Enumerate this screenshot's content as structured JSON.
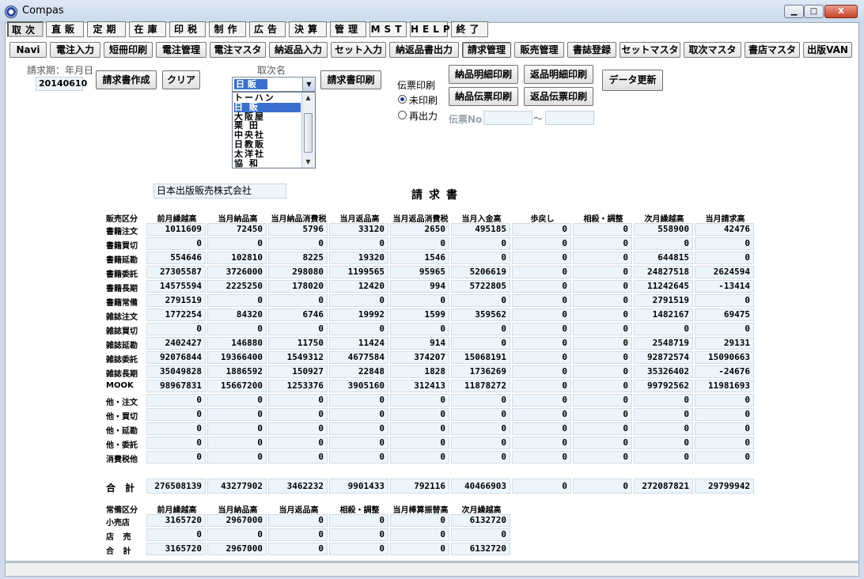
{
  "window": {
    "title": "Compas",
    "minimize": "▁",
    "maximize": "□",
    "close": "X"
  },
  "menu": [
    {
      "label": "取次"
    },
    {
      "label": "直販"
    },
    {
      "label": "定期"
    },
    {
      "label": "在庫"
    },
    {
      "label": "印税"
    },
    {
      "label": "制作"
    },
    {
      "label": "広告"
    },
    {
      "label": "決算"
    },
    {
      "label": "管理"
    },
    {
      "label": "MST"
    },
    {
      "label": "HELP"
    },
    {
      "label": "終了"
    }
  ],
  "submenu": [
    {
      "label": "Navi"
    },
    {
      "label": "電注入力"
    },
    {
      "label": "短冊印刷"
    },
    {
      "label": "電注管理"
    },
    {
      "label": "電注マスタ"
    },
    {
      "label": "納返品入力"
    },
    {
      "label": "セット入力"
    },
    {
      "label": "納返品書出力"
    },
    {
      "label": "請求管理"
    },
    {
      "label": "販売管理"
    },
    {
      "label": "書誌登録"
    },
    {
      "label": "セットマスタ"
    },
    {
      "label": "取次マスタ"
    },
    {
      "label": "書店マスタ"
    },
    {
      "label": "出版VAN"
    }
  ],
  "controls": {
    "period_label": "請求期：年月日",
    "period_value": "20140610",
    "create_btn": "請求書作成",
    "clear_btn": "クリア",
    "distributor_label": "取次名",
    "distributor_value": "日 販",
    "distributor_options": [
      "トーハン",
      "日 販",
      "大阪屋",
      "栗 田",
      "中央社",
      "日教販",
      "太洋社",
      "協 和"
    ],
    "print_invoice_btn": "請求書印刷",
    "slip_label": "伝票印刷",
    "radio_unprinted": "未印刷",
    "radio_reprint": "再出力",
    "delivery_detail_btn": "納品明細印刷",
    "return_detail_btn": "返品明細印刷",
    "delivery_slip_btn": "納品伝票印刷",
    "return_slip_btn": "返品伝票印刷",
    "update_btn": "データ更新",
    "slip_no_label": "伝票No",
    "slip_range": "〜"
  },
  "company": "日本出版販売株式会社",
  "doc_title": "請求書",
  "main_table": {
    "headers": [
      "販売区分",
      "前月繰越高",
      "当月納品高",
      "当月納品消費税",
      "当月返品高",
      "当月返品消費税",
      "当月入金高",
      "歩戻し",
      "相殺・調整",
      "次月繰越高",
      "当月請求高"
    ],
    "rows": [
      {
        "label": "書籍注文",
        "values": [
          "1011609",
          "72450",
          "5796",
          "33120",
          "2650",
          "495185",
          "0",
          "0",
          "558900",
          "42476"
        ]
      },
      {
        "label": "書籍買切",
        "values": [
          "0",
          "0",
          "0",
          "0",
          "0",
          "0",
          "0",
          "0",
          "0",
          "0"
        ]
      },
      {
        "label": "書籍延勘",
        "values": [
          "554646",
          "102810",
          "8225",
          "19320",
          "1546",
          "0",
          "0",
          "0",
          "644815",
          "0"
        ]
      },
      {
        "label": "書籍委託",
        "values": [
          "27305587",
          "3726000",
          "298080",
          "1199565",
          "95965",
          "5206619",
          "0",
          "0",
          "24827518",
          "2624594"
        ]
      },
      {
        "label": "書籍長期",
        "values": [
          "14575594",
          "2225250",
          "178020",
          "12420",
          "994",
          "5722805",
          "0",
          "0",
          "11242645",
          "-13414"
        ]
      },
      {
        "label": "書籍常備",
        "values": [
          "2791519",
          "0",
          "0",
          "0",
          "0",
          "0",
          "0",
          "0",
          "2791519",
          "0"
        ]
      },
      {
        "label": "雑誌注文",
        "values": [
          "1772254",
          "84320",
          "6746",
          "19992",
          "1599",
          "359562",
          "0",
          "0",
          "1482167",
          "69475"
        ]
      },
      {
        "label": "雑誌買切",
        "values": [
          "0",
          "0",
          "0",
          "0",
          "0",
          "0",
          "0",
          "0",
          "0",
          "0"
        ]
      },
      {
        "label": "雑誌延勘",
        "values": [
          "2402427",
          "146880",
          "11750",
          "11424",
          "914",
          "0",
          "0",
          "0",
          "2548719",
          "29131"
        ]
      },
      {
        "label": "雑誌委託",
        "values": [
          "92076844",
          "19366400",
          "1549312",
          "4677584",
          "374207",
          "15068191",
          "0",
          "0",
          "92872574",
          "15090663"
        ]
      },
      {
        "label": "雑誌長期",
        "values": [
          "35049828",
          "1886592",
          "150927",
          "22848",
          "1828",
          "1736269",
          "0",
          "0",
          "35326402",
          "-24676"
        ]
      },
      {
        "label": "MOOK",
        "values": [
          "98967831",
          "15667200",
          "1253376",
          "3905160",
          "312413",
          "11878272",
          "0",
          "0",
          "99792562",
          "11981693"
        ]
      },
      {
        "label": "他・注文",
        "values": [
          "0",
          "0",
          "0",
          "0",
          "0",
          "0",
          "0",
          "0",
          "0",
          "0"
        ]
      },
      {
        "label": "他・買切",
        "values": [
          "0",
          "0",
          "0",
          "0",
          "0",
          "0",
          "0",
          "0",
          "0",
          "0"
        ]
      },
      {
        "label": "他・延勘",
        "values": [
          "0",
          "0",
          "0",
          "0",
          "0",
          "0",
          "0",
          "0",
          "0",
          "0"
        ]
      },
      {
        "label": "他・委託",
        "values": [
          "0",
          "0",
          "0",
          "0",
          "0",
          "0",
          "0",
          "0",
          "0",
          "0"
        ]
      },
      {
        "label": "消費税他",
        "values": [
          "0",
          "0",
          "0",
          "0",
          "0",
          "0",
          "0",
          "0",
          "0",
          "0"
        ]
      }
    ],
    "total": {
      "label": "合 計",
      "values": [
        "276508139",
        "43277902",
        "3462232",
        "9901433",
        "792116",
        "40466903",
        "0",
        "0",
        "272087821",
        "29799942"
      ]
    }
  },
  "standing_table": {
    "headers": [
      "常備区分",
      "前月繰越高",
      "当月納品高",
      "当月返品高",
      "相殺・調整",
      "当月棒算振替高",
      "次月繰越高"
    ],
    "rows": [
      {
        "label": "小売店",
        "values": [
          "3165720",
          "2967000",
          "0",
          "0",
          "0",
          "6132720"
        ]
      },
      {
        "label": "店 売",
        "values": [
          "0",
          "0",
          "0",
          "0",
          "0",
          "0"
        ]
      },
      {
        "label": "合 計",
        "values": [
          "3165720",
          "2967000",
          "0",
          "0",
          "0",
          "6132720"
        ]
      }
    ]
  }
}
